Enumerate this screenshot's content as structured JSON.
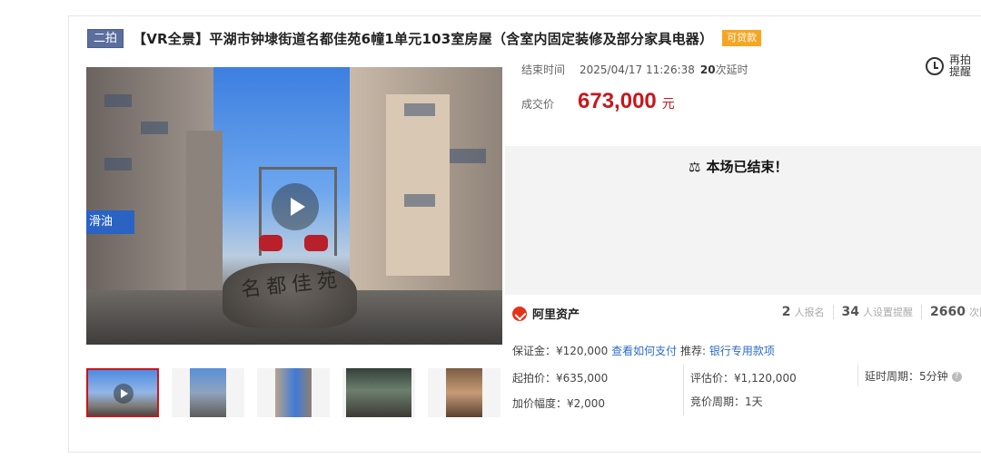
{
  "title": {
    "round_badge": "二拍",
    "text": "【VR全景】平湖市钟埭街道名都佳苑6幢1单元103室房屋（含室内固定装修及部分家具电器）",
    "loan_badge": "可贷款"
  },
  "main_image": {
    "shop_sign": "滑油",
    "rock_inscription": "名都佳苑"
  },
  "auction": {
    "end_time_label": "结束时间",
    "end_time_value": "2025/04/17 11:26:38",
    "delay_count": "20",
    "delay_suffix": "次延时",
    "remind_label": "再拍提醒",
    "deal_price_label": "成交价",
    "deal_price": "673,000",
    "deal_price_unit": "元",
    "ended_notice": "本场已结束！"
  },
  "platform": {
    "name": "阿里资产"
  },
  "stats": {
    "registered_count": "2",
    "registered_label": "人报名",
    "reminder_count": "34",
    "reminder_label": "人设置提醒",
    "views_count": "2660",
    "views_label": "次围观"
  },
  "details": {
    "deposit": "保证金：¥120,000",
    "deposit_link": "查看如何支付",
    "recommend_label": "推荐:",
    "recommend_link": "银行专用款项",
    "start_price": "起拍价：¥635,000",
    "appraisal_price": "评估价：¥1,120,000",
    "delay_period": "延时周期：5分钟",
    "increment": "加价幅度：¥2,000",
    "bid_period": "竞价周期：1天"
  },
  "colors": {
    "accent_red": "#c8161d",
    "round_badge": "#5a6f9e",
    "loan_badge": "#f5a623",
    "link_blue": "#2c6cc9"
  },
  "icons": [
    "play-icon",
    "clock-icon",
    "gavel-icon",
    "ali-asset-logo-icon",
    "help-icon"
  ]
}
